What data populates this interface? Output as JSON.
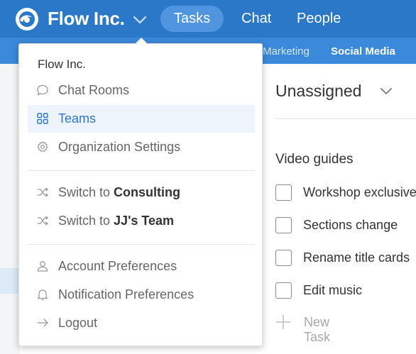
{
  "header": {
    "brand": "Flow Inc.",
    "tabs": [
      {
        "label": "Tasks",
        "active": true
      },
      {
        "label": "Chat",
        "active": false
      },
      {
        "label": "People",
        "active": false
      }
    ]
  },
  "subnav": {
    "tabs": [
      {
        "label": "Marketing",
        "active": false
      },
      {
        "label": "Social Media",
        "active": true
      }
    ]
  },
  "dropdown": {
    "org_name": "Flow Inc.",
    "items": [
      {
        "label": "Chat Rooms",
        "icon": "chat-bubble-icon",
        "selected": false
      },
      {
        "label": "Teams",
        "icon": "grid-icon",
        "selected": true
      },
      {
        "label": "Organization Settings",
        "icon": "gear-icon",
        "selected": false
      }
    ],
    "switch_items": [
      {
        "prefix": "Switch to",
        "target": "Consulting",
        "icon": "shuffle-icon"
      },
      {
        "prefix": "Switch to",
        "target": "JJ's Team",
        "icon": "shuffle-icon"
      }
    ],
    "account_items": [
      {
        "label": "Account Preferences",
        "icon": "user-icon"
      },
      {
        "label": "Notification Preferences",
        "icon": "bell-icon"
      },
      {
        "label": "Logout",
        "icon": "arrow-right-icon"
      }
    ]
  },
  "main": {
    "column_title": "Unassigned",
    "section_title": "Video guides",
    "tasks": [
      {
        "label": "Workshop exclusive",
        "done": false
      },
      {
        "label": "Sections change",
        "done": false
      },
      {
        "label": "Rename title cards",
        "done": false
      },
      {
        "label": "Edit music",
        "done": false
      }
    ],
    "new_task_label": "New Task"
  },
  "colors": {
    "topbar": "#2b78c9",
    "subbar": "#3b89db",
    "active_tab": "#4f95e0",
    "selected_item_bg": "#eef4fb",
    "accent_text": "#2b78c9"
  }
}
